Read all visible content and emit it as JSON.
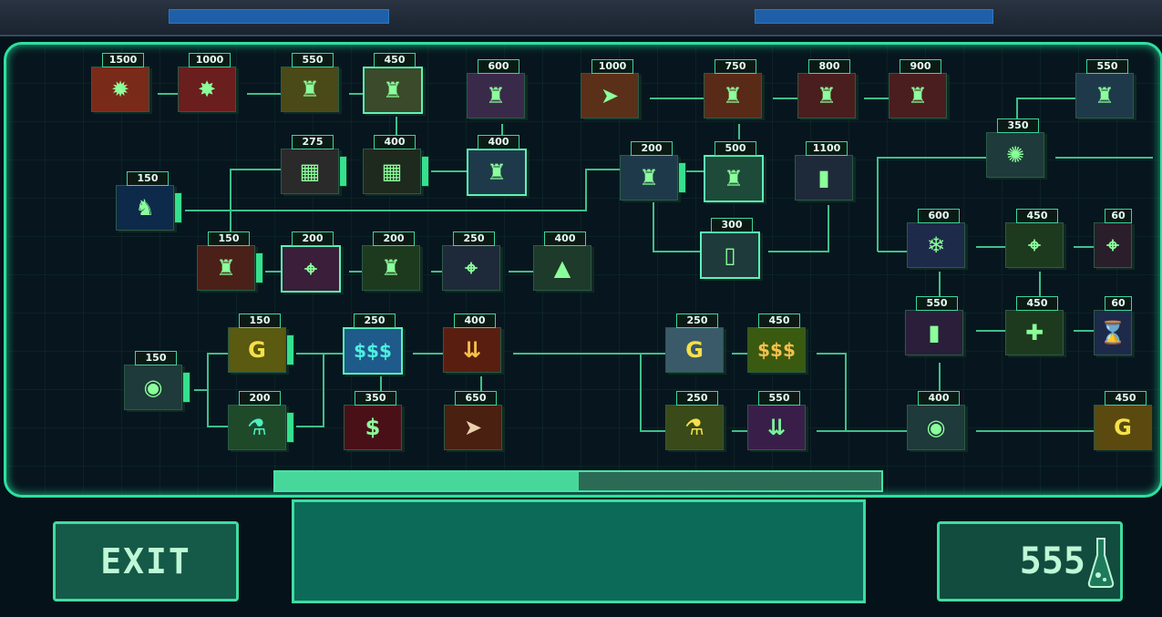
{
  "nodes": [
    {
      "id": "n1",
      "price": "1500",
      "glyph": "✹",
      "color": "#7a2a18"
    },
    {
      "id": "n2",
      "price": "1000",
      "glyph": "✸",
      "color": "#6a1e1e"
    },
    {
      "id": "n3",
      "price": "550",
      "glyph": "♜",
      "color": "#4a4a18"
    },
    {
      "id": "n4",
      "price": "450",
      "glyph": "♜",
      "color": "#3a4a2a"
    },
    {
      "id": "n5",
      "price": "600",
      "glyph": "♜",
      "color": "#3a2a4a"
    },
    {
      "id": "n6",
      "price": "1000",
      "glyph": "➤",
      "color": "#5a3018"
    },
    {
      "id": "n7",
      "price": "750",
      "glyph": "♜",
      "color": "#5a2a18"
    },
    {
      "id": "n8",
      "price": "800",
      "glyph": "♜",
      "color": "#4a1e1e"
    },
    {
      "id": "n9",
      "price": "900",
      "glyph": "♜",
      "color": "#4a1e1e"
    },
    {
      "id": "n10",
      "price": "550",
      "glyph": "♜",
      "color": "#1e3a4a"
    },
    {
      "id": "n11",
      "price": "350",
      "glyph": "✺",
      "color": "#1e3a3a"
    },
    {
      "id": "n12",
      "price": "275",
      "glyph": "▦",
      "color": "#2a2a2a"
    },
    {
      "id": "n13",
      "price": "400",
      "glyph": "▦",
      "color": "#1e2a1e"
    },
    {
      "id": "n14",
      "price": "400",
      "glyph": "♜",
      "color": "#1e3a4a"
    },
    {
      "id": "n15",
      "price": "200",
      "glyph": "♜",
      "color": "#1e3a4a"
    },
    {
      "id": "n16",
      "price": "500",
      "glyph": "♜",
      "color": "#1e4a3a"
    },
    {
      "id": "n17",
      "price": "1100",
      "glyph": "▮",
      "color": "#1e2a3a"
    },
    {
      "id": "n18",
      "price": "150",
      "glyph": "♞",
      "color": "#0e2a4a"
    },
    {
      "id": "n19",
      "price": "300",
      "glyph": "▯",
      "color": "#1e3a3a"
    },
    {
      "id": "n20",
      "price": "600",
      "glyph": "❄",
      "color": "#1e2a4a"
    },
    {
      "id": "n21",
      "price": "450",
      "glyph": "⌖",
      "color": "#1e3a1e"
    },
    {
      "id": "n22",
      "price": "60",
      "glyph": "⌖",
      "color": "#2a1e2a"
    },
    {
      "id": "n23",
      "price": "150",
      "glyph": "♜",
      "color": "#4a2018"
    },
    {
      "id": "n24",
      "price": "200",
      "glyph": "⌖",
      "color": "#3a1e3a"
    },
    {
      "id": "n25",
      "price": "200",
      "glyph": "♜",
      "color": "#1e3a1e"
    },
    {
      "id": "n26",
      "price": "250",
      "glyph": "⌖",
      "color": "#1e2a3a"
    },
    {
      "id": "n27",
      "price": "400",
      "glyph": "▲",
      "color": "#1e3a2a"
    },
    {
      "id": "n28",
      "price": "550",
      "glyph": "▮",
      "color": "#2a1e3a"
    },
    {
      "id": "n29",
      "price": "450",
      "glyph": "✚",
      "color": "#1e3a1e"
    },
    {
      "id": "n30",
      "price": "60",
      "glyph": "⌛",
      "color": "#1e2a4a"
    },
    {
      "id": "n31",
      "price": "150",
      "glyph": "◉",
      "color": "#1e3a3a"
    },
    {
      "id": "n32",
      "price": "150",
      "glyph": "G",
      "color": "#5a5a10"
    },
    {
      "id": "n33",
      "price": "250",
      "glyph": "$$$",
      "color": "#1e5a8a"
    },
    {
      "id": "n34",
      "price": "400",
      "glyph": "⇊",
      "color": "#5a1e10"
    },
    {
      "id": "n35",
      "price": "250",
      "glyph": "G",
      "color": "#3a5a6a"
    },
    {
      "id": "n36",
      "price": "450",
      "glyph": "$$$",
      "color": "#3a5a10"
    },
    {
      "id": "n37",
      "price": "200",
      "glyph": "⚗",
      "color": "#1e4a2a"
    },
    {
      "id": "n38",
      "price": "350",
      "glyph": "$",
      "color": "#4a1018"
    },
    {
      "id": "n39",
      "price": "650",
      "glyph": "➤",
      "color": "#4a2010"
    },
    {
      "id": "n40",
      "price": "250",
      "glyph": "⚗",
      "color": "#3a4a18"
    },
    {
      "id": "n41",
      "price": "550",
      "glyph": "⇊",
      "color": "#3a1e4a"
    },
    {
      "id": "n42",
      "price": "400",
      "glyph": "◉",
      "color": "#1e3a3a"
    },
    {
      "id": "n43",
      "price": "450",
      "glyph": "G",
      "color": "#5a4a10"
    }
  ],
  "scroll": {
    "thumb_fraction": 0.5
  },
  "exit_label": "EXIT",
  "currency": {
    "value": "555",
    "icon": "flask-icon"
  },
  "colors": {
    "accent": "#3fdca0",
    "panel": "#07161e",
    "line": "#3fbf8a"
  }
}
